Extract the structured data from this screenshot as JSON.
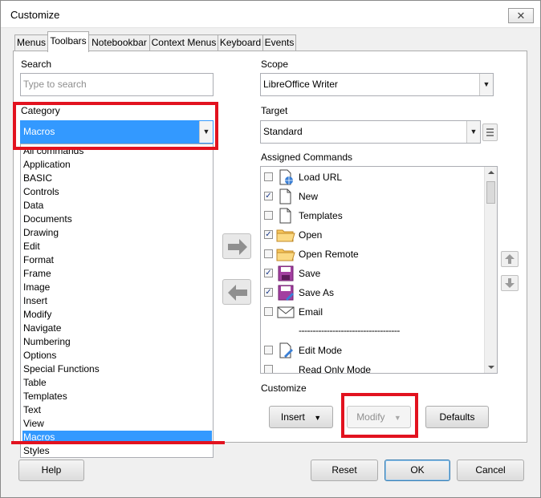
{
  "window": {
    "title": "Customize",
    "close_glyph": "✕"
  },
  "tabs": [
    {
      "label": "Menus"
    },
    {
      "label": "Toolbars"
    },
    {
      "label": "Notebookbar"
    },
    {
      "label": "Context Menus"
    },
    {
      "label": "Keyboard"
    },
    {
      "label": "Events"
    }
  ],
  "left": {
    "search_label": "Search",
    "search_placeholder": "Type to search",
    "category_label": "Category",
    "category_value": "Macros",
    "category_items": [
      "All commands",
      "Application",
      "BASIC",
      "Controls",
      "Data",
      "Documents",
      "Drawing",
      "Edit",
      "Format",
      "Frame",
      "Image",
      "Insert",
      "Modify",
      "Navigate",
      "Numbering",
      "Options",
      "Special Functions",
      "Table",
      "Templates",
      "Text",
      "View",
      "Macros",
      "Styles"
    ],
    "selected_item": "Macros"
  },
  "right": {
    "scope_label": "Scope",
    "scope_value": "LibreOffice Writer",
    "target_label": "Target",
    "target_value": "Standard",
    "assigned_label": "Assigned Commands",
    "commands": [
      {
        "label": "Load URL",
        "checked": false,
        "icon": "load-url-icon"
      },
      {
        "label": "New",
        "checked": true,
        "icon": "new-document-icon"
      },
      {
        "label": "Templates",
        "checked": false,
        "icon": "templates-icon"
      },
      {
        "label": "Open",
        "checked": true,
        "icon": "open-folder-icon"
      },
      {
        "label": "Open Remote",
        "checked": false,
        "icon": "open-remote-icon"
      },
      {
        "label": "Save",
        "checked": true,
        "icon": "save-icon"
      },
      {
        "label": "Save As",
        "checked": true,
        "icon": "save-as-icon"
      },
      {
        "label": "Email",
        "checked": false,
        "icon": "email-icon"
      },
      {
        "label": "------------------------------------",
        "separator": true
      },
      {
        "label": "Edit Mode",
        "checked": false,
        "icon": "edit-mode-icon"
      },
      {
        "label": "Read Only Mode",
        "checked": false,
        "icon": "read-only-icon"
      }
    ],
    "customize_label": "Customize",
    "insert_label": "Insert",
    "modify_label": "Modify",
    "defaults_label": "Defaults"
  },
  "footer": {
    "help_label": "Help",
    "reset_label": "Reset",
    "ok_label": "OK",
    "cancel_label": "Cancel"
  },
  "colors": {
    "selection": "#3399ff",
    "highlight_annotation": "#e2121f",
    "window_bg": "#f0f0f0"
  }
}
